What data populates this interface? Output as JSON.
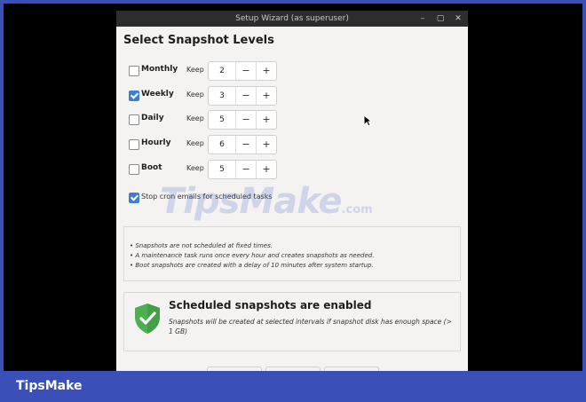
{
  "window": {
    "title": "Setup Wizard (as superuser)",
    "controls": [
      "–",
      "▢",
      "✕"
    ]
  },
  "heading": "Select Snapshot Levels",
  "keep_label": "Keep",
  "levels": [
    {
      "label": "Monthly",
      "checked": false,
      "value": "2"
    },
    {
      "label": "Weekly",
      "checked": true,
      "value": "3"
    },
    {
      "label": "Daily",
      "checked": false,
      "value": "5"
    },
    {
      "label": "Hourly",
      "checked": false,
      "value": "6"
    },
    {
      "label": "Boot",
      "checked": false,
      "value": "5"
    }
  ],
  "spin": {
    "minus": "−",
    "plus": "+"
  },
  "cron": {
    "label": "Stop cron emails for scheduled tasks",
    "checked": true
  },
  "notes": [
    "• Snapshots are not scheduled at fixed times.",
    "• A maintenance task runs once every hour and creates snapshots as needed.",
    "• Boot snapshots are created with a delay of 10 minutes after system startup."
  ],
  "status": {
    "title": "Scheduled snapshots are enabled",
    "description": "Snapshots will be created at selected intervals if snapshot disk has enough space (> 1 GB)",
    "icon": "shield-check-icon",
    "icon_color": "#4caf50"
  },
  "watermark": {
    "main": "TipsMake",
    "suffix": ".com"
  },
  "brand": "TipsMake",
  "colors": {
    "accent": "#3c7fd0",
    "frame": "#3a4fb8"
  }
}
